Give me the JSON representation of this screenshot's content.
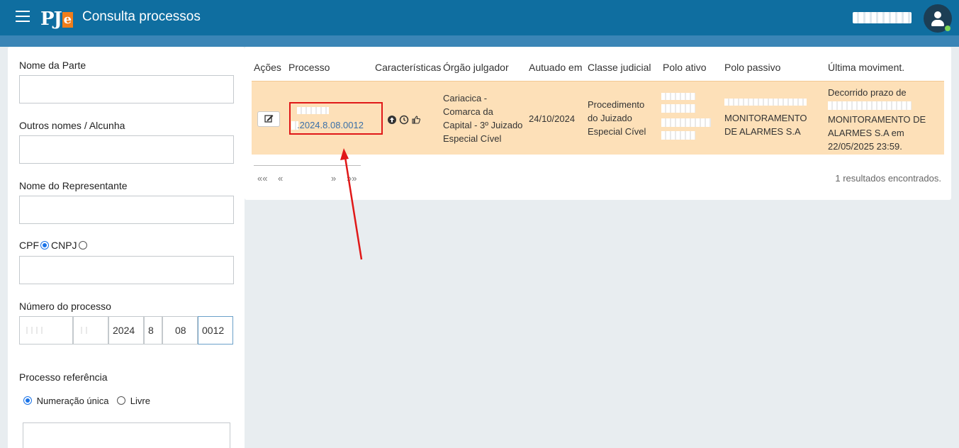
{
  "header": {
    "logo_text": "PJ",
    "logo_e": "e",
    "title": "Consulta processos"
  },
  "filters": {
    "nome_parte_label": "Nome da Parte",
    "outros_nomes_label": "Outros nomes / Alcunha",
    "representante_label": "Nome do Representante",
    "cpf_label": "CPF",
    "cnpj_label": "CNPJ",
    "numero_label": "Número do processo",
    "numero_segments": [
      "",
      "",
      "2024",
      "8",
      "08",
      "0012"
    ],
    "referencia_label": "Processo referência",
    "numeracao_unica_label": "Numeração única",
    "livre_label": "Livre"
  },
  "table": {
    "headers": [
      "Ações",
      "Processo",
      "Características",
      "Órgão julgador",
      "Autuado em",
      "Classe judicial",
      "Polo ativo",
      "Polo passivo",
      "Última moviment."
    ],
    "row": {
      "processo": ".2024.8.08.0012",
      "orgao": [
        "Cariacica -",
        "Comarca da",
        "Capital - 3º Juizado",
        "Especial Cível"
      ],
      "autuado": "24/10/2024",
      "classe": [
        "Procedimento",
        "do Juizado",
        "Especial Cível"
      ],
      "polo_passivo": [
        "MONITORAMENTO",
        "DE ALARMES S.A"
      ],
      "ultima": [
        "Decorrido prazo de",
        "MONITORAMENTO DE",
        "ALARMES S.A em",
        "22/05/2025 23:59."
      ]
    }
  },
  "pager": {
    "first": "««",
    "prev": "«",
    "next": "»",
    "last": "»»",
    "count": "1 resultados encontrados."
  },
  "colors": {
    "topbar": "#0f6ea0",
    "row_highlight": "#fde0b8",
    "annotation": "#e01818"
  }
}
